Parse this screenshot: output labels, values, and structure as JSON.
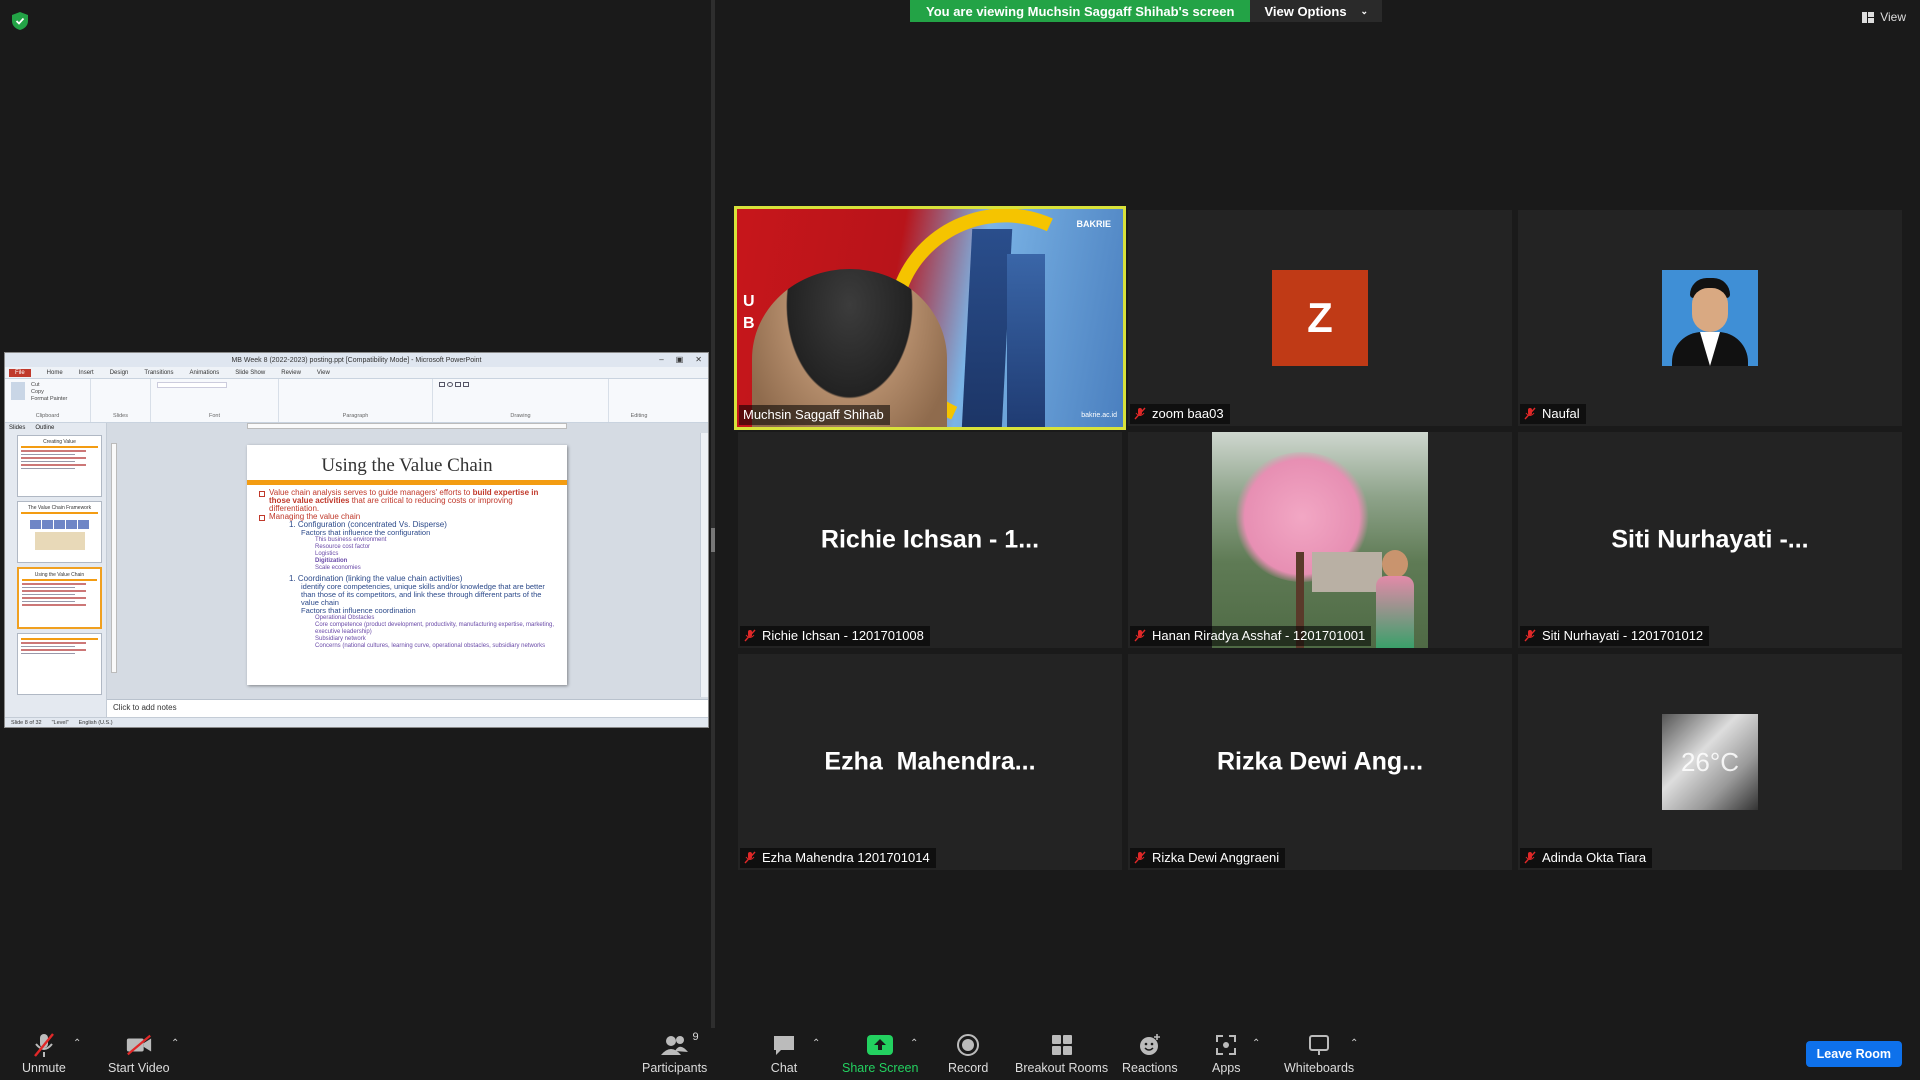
{
  "banner": {
    "viewing_text": "You are viewing Muchsin Saggaff Shihab's screen",
    "view_options_label": "View Options",
    "view_label": "View"
  },
  "share": {
    "window_title": "MB Week 8 (2022-2023) posting.ppt [Compatibility Mode] - Microsoft PowerPoint",
    "ribbon_tabs": [
      "File",
      "Home",
      "Insert",
      "Design",
      "Transitions",
      "Animations",
      "Slide Show",
      "Review",
      "View"
    ],
    "ribbon_groups": [
      "Clipboard",
      "Slides",
      "Font",
      "Paragraph",
      "Drawing",
      "Editing"
    ],
    "clipboard_items": [
      "Cut",
      "Copy",
      "Format Painter"
    ],
    "pane_tabs": [
      "Slides",
      "Outline"
    ],
    "thumb_titles": [
      "Creating Value",
      "The Value Chain Framework",
      "Using the Value Chain",
      ""
    ],
    "slide": {
      "title": "Using the Value Chain",
      "b1_pre": "Value chain analysis serves to guide managers' efforts to ",
      "b1_bold": "build expertise in those value activities",
      "b1_post": " that are critical to reducing costs or improving differentiation.",
      "b2": "Managing the value chain",
      "b2_1": "1. Configuration (concentrated Vs. Disperse)",
      "b2_1_a": "Factors that influence the configuration",
      "b2_1_a_items": [
        "This business environment",
        "Resource cost factor",
        "Logistics",
        "Digitization",
        "Scale economies"
      ],
      "b2_2": "1. Coordination (linking the value chain activities)",
      "b2_2_a": "identify core competencies, unique skills and/or knowledge that are better than those of its competitors, and link these through different parts of the value chain",
      "b2_2_b": "Factors that influence coordination",
      "b2_2_b_items": [
        "Operational Obstacles",
        "Core competence (product development, productivity, manufacturing expertise, marketing, executive leadership)",
        "Subsidiary network",
        "Concerns (national cultures, learning curve, operational obstacles, subsidiary networks"
      ]
    },
    "notes_placeholder": "Click to add notes",
    "status": [
      "Slide 8 of 32",
      "\"Level\"",
      "English (U.S.)"
    ]
  },
  "participants": [
    {
      "display": "",
      "name": "Muchsin Saggaff Shihab",
      "muted": false,
      "active": true,
      "media": "video"
    },
    {
      "display": "Z",
      "name": "zoom baa03",
      "muted": true,
      "media": "avatar-letter"
    },
    {
      "display": "",
      "name": "Naufal",
      "muted": true,
      "media": "avatar-photo"
    },
    {
      "display": "Richie Ichsan - 1...",
      "name": "Richie Ichsan - 1201701008",
      "muted": true,
      "media": "text"
    },
    {
      "display": "",
      "name": "Hanan Riradya Asshaf - 1201701001",
      "muted": true,
      "media": "photo"
    },
    {
      "display": "Siti Nurhayati -...",
      "name": "Siti Nurhayati - 1201701012",
      "muted": true,
      "media": "text"
    },
    {
      "display": "Ezha  Mahendra...",
      "name": "Ezha Mahendra 1201701014",
      "muted": true,
      "media": "text"
    },
    {
      "display": "Rizka Dewi Ang...",
      "name": "Rizka Dewi Anggraeni",
      "muted": true,
      "media": "text"
    },
    {
      "display": "26°C",
      "name": "Adinda Okta Tiara",
      "muted": true,
      "media": "avatar-photo"
    }
  ],
  "video_overlay": {
    "letters": "U\nB",
    "brand": "BAKRIE",
    "site": "bakrie.ac.id"
  },
  "toolbar": {
    "unmute": "Unmute",
    "start_video": "Start Video",
    "participants": "Participants",
    "participants_count": "9",
    "chat": "Chat",
    "share_screen": "Share Screen",
    "record": "Record",
    "breakout_rooms": "Breakout Rooms",
    "reactions": "Reactions",
    "apps": "Apps",
    "whiteboards": "Whiteboards",
    "leave_room": "Leave Room"
  },
  "colors": {
    "banner_green": "#23a346",
    "active_border": "#d8e23a",
    "avatar_z": "#c03a16",
    "leave_blue": "#0e71eb",
    "mute_red": "#e02828"
  }
}
